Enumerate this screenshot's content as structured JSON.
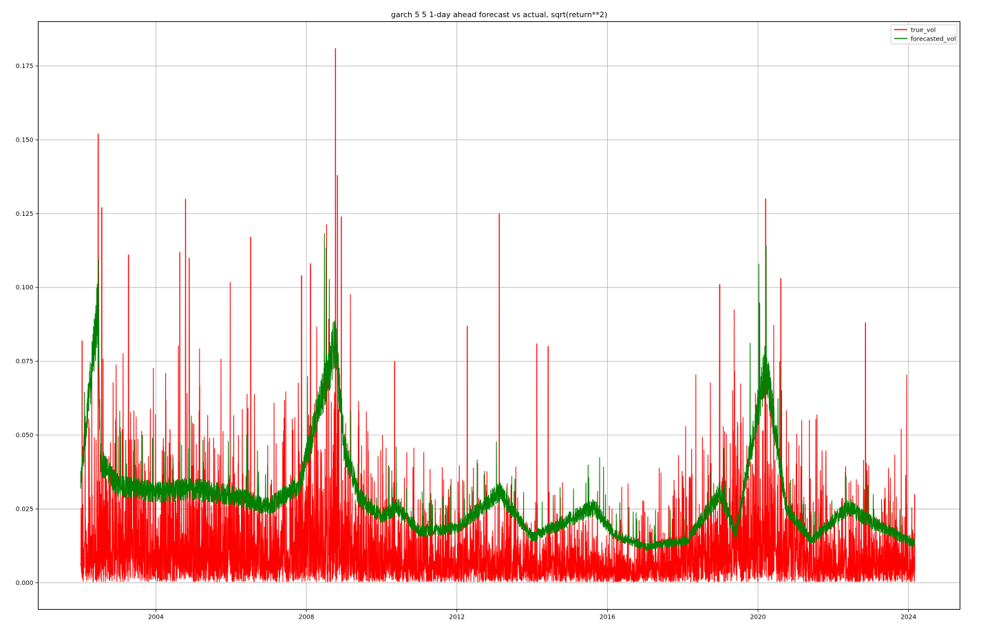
{
  "chart_data": {
    "type": "line",
    "title": "garch 5 5 1-day ahead forecast vs actual, sqrt(return**2)",
    "xlabel": "",
    "ylabel": "",
    "x_ticks": [
      "2004",
      "2008",
      "2012",
      "2016",
      "2020",
      "2024"
    ],
    "y_ticks": [
      "0.000",
      "0.025",
      "0.050",
      "0.075",
      "0.100",
      "0.125",
      "0.150",
      "0.175"
    ],
    "xlim": [
      "2000-11-15",
      "2025-05-15"
    ],
    "ylim": [
      -0.009,
      0.19
    ],
    "grid": true,
    "legend_position": "top-right",
    "colors": {
      "true_vol": "#ff0000",
      "forecasted_vol": "#008000"
    },
    "series": [
      {
        "name": "true_vol",
        "notable_spikes": [
          {
            "date": "2002-01-15",
            "value": 0.082
          },
          {
            "date": "2002-06-20",
            "value": 0.152
          },
          {
            "date": "2002-07-25",
            "value": 0.127
          },
          {
            "date": "2003-04-10",
            "value": 0.111
          },
          {
            "date": "2004-08-20",
            "value": 0.112
          },
          {
            "date": "2004-10-15",
            "value": 0.13
          },
          {
            "date": "2004-11-20",
            "value": 0.11
          },
          {
            "date": "2006-07-10",
            "value": 0.117
          },
          {
            "date": "2007-11-15",
            "value": 0.104
          },
          {
            "date": "2008-02-10",
            "value": 0.108
          },
          {
            "date": "2008-10-10",
            "value": 0.181
          },
          {
            "date": "2008-10-28",
            "value": 0.138
          },
          {
            "date": "2008-12-05",
            "value": 0.124
          },
          {
            "date": "2010-05-07",
            "value": 0.075
          },
          {
            "date": "2012-04-10",
            "value": 0.087
          },
          {
            "date": "2013-02-15",
            "value": 0.125
          },
          {
            "date": "2014-02-15",
            "value": 0.081
          },
          {
            "date": "2014-06-05",
            "value": 0.08
          },
          {
            "date": "2018-12-26",
            "value": 0.101
          },
          {
            "date": "2020-03-16",
            "value": 0.13
          },
          {
            "date": "2020-08-10",
            "value": 0.103
          },
          {
            "date": "2022-11-10",
            "value": 0.088
          },
          {
            "date": "2024-03-01",
            "value": 0.03
          }
        ],
        "baseline_level": [
          {
            "date": "2002-01-01",
            "value": 0.017
          },
          {
            "date": "2004-01-01",
            "value": 0.015
          },
          {
            "date": "2006-01-01",
            "value": 0.014
          },
          {
            "date": "2007-06-01",
            "value": 0.013
          },
          {
            "date": "2008-10-01",
            "value": 0.025
          },
          {
            "date": "2009-06-01",
            "value": 0.012
          },
          {
            "date": "2011-01-01",
            "value": 0.009
          },
          {
            "date": "2014-01-01",
            "value": 0.008
          },
          {
            "date": "2017-01-01",
            "value": 0.006
          },
          {
            "date": "2020-03-01",
            "value": 0.02
          },
          {
            "date": "2021-06-01",
            "value": 0.009
          },
          {
            "date": "2024-03-01",
            "value": 0.009
          }
        ]
      },
      {
        "name": "forecasted_vol",
        "x": [
          "2002-01-01",
          "2002-06-15",
          "2002-07-15",
          "2003-01-01",
          "2004-01-01",
          "2005-01-01",
          "2006-01-01",
          "2007-01-01",
          "2007-11-01",
          "2008-10-10",
          "2009-01-01",
          "2009-06-01",
          "2010-01-01",
          "2010-06-01",
          "2011-01-01",
          "2012-01-01",
          "2013-02-15",
          "2014-01-01",
          "2015-09-01",
          "2016-03-01",
          "2017-01-01",
          "2018-02-15",
          "2018-12-26",
          "2019-06-01",
          "2020-03-16",
          "2020-10-01",
          "2021-06-01",
          "2022-06-01",
          "2023-01-01",
          "2024-03-01"
        ],
        "y": [
          0.034,
          0.09,
          0.04,
          0.032,
          0.03,
          0.031,
          0.029,
          0.025,
          0.033,
          0.08,
          0.045,
          0.028,
          0.022,
          0.025,
          0.017,
          0.018,
          0.03,
          0.015,
          0.025,
          0.016,
          0.012,
          0.014,
          0.03,
          0.016,
          0.072,
          0.025,
          0.014,
          0.025,
          0.02,
          0.013
        ]
      }
    ]
  }
}
